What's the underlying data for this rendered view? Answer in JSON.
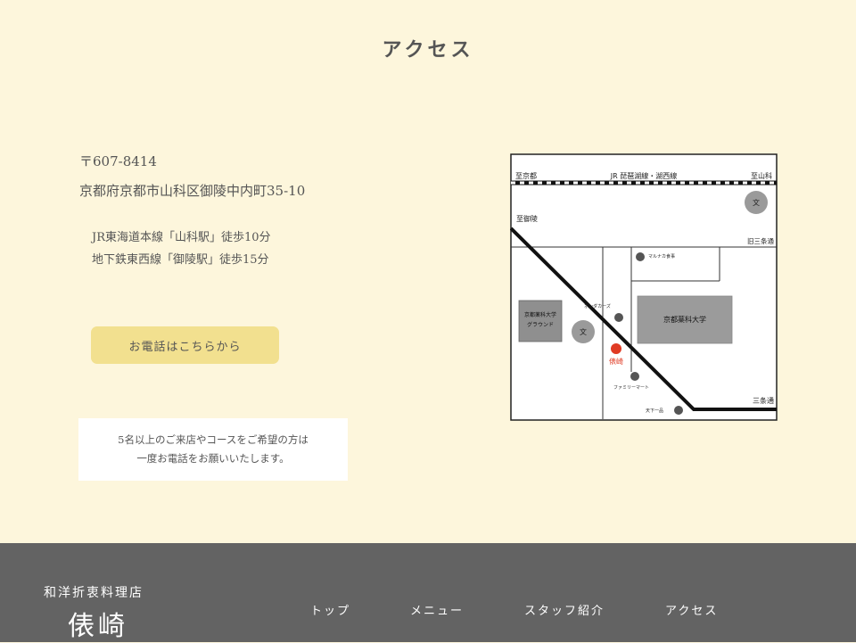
{
  "page": {
    "title": "アクセス"
  },
  "access": {
    "postal": "〒607-8414",
    "address": "京都府京都市山科区御陵中内町35-10",
    "routes": [
      "JR東海道本線「山科駅」徒歩10分",
      "地下鉄東西線「御陵駅」徒歩15分"
    ],
    "phone_button": "お電話はこちらから",
    "notice_lines": [
      "5名以上のご来店やコースをご希望の方は",
      "一度お電話をお願いいたします。"
    ]
  },
  "map": {
    "rail_label": "JR 琵琶湖線・湖西線",
    "to_kyoto": "至京都",
    "to_yamashina": "至山科",
    "to_misasagi": "至御陵",
    "kyu_sanjo": "旧三条通",
    "sanjo": "三条通",
    "school_mark": "文",
    "marunaka": "マルナカ食事",
    "honda_cars": "ホンダカーズ",
    "ground_line1": "京都薬科大学",
    "ground_line2": "グラウンド",
    "university": "京都薬科大学",
    "shop": "俵崎",
    "family_mart": "ファミリーマート",
    "tenkaippin": "天下一品",
    "shop_color": "#e03b24"
  },
  "footer": {
    "subtitle": "和洋折衷料理店",
    "logo": "俵崎",
    "nav": [
      "トップ",
      "メニュー",
      "スタッフ紹介",
      "アクセス"
    ]
  }
}
